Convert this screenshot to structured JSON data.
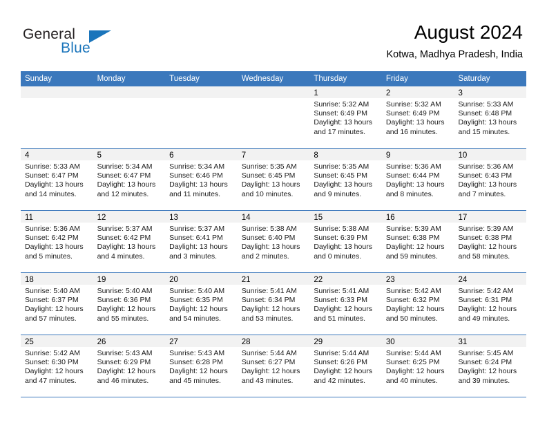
{
  "brand": {
    "name_part1": "General",
    "name_part2": "Blue",
    "accent_color": "#1b75bb"
  },
  "header": {
    "title": "August 2024",
    "subtitle": "Kotwa, Madhya Pradesh, India"
  },
  "calendar": {
    "header_color": "#3b78bc",
    "weekdays": [
      "Sunday",
      "Monday",
      "Tuesday",
      "Wednesday",
      "Thursday",
      "Friday",
      "Saturday"
    ],
    "weeks": [
      [
        {
          "day": "",
          "empty": true
        },
        {
          "day": "",
          "empty": true
        },
        {
          "day": "",
          "empty": true
        },
        {
          "day": "",
          "empty": true
        },
        {
          "day": "1",
          "sunrise": "Sunrise: 5:32 AM",
          "sunset": "Sunset: 6:49 PM",
          "daylight1": "Daylight: 13 hours",
          "daylight2": "and 17 minutes."
        },
        {
          "day": "2",
          "sunrise": "Sunrise: 5:32 AM",
          "sunset": "Sunset: 6:49 PM",
          "daylight1": "Daylight: 13 hours",
          "daylight2": "and 16 minutes."
        },
        {
          "day": "3",
          "sunrise": "Sunrise: 5:33 AM",
          "sunset": "Sunset: 6:48 PM",
          "daylight1": "Daylight: 13 hours",
          "daylight2": "and 15 minutes."
        }
      ],
      [
        {
          "day": "4",
          "sunrise": "Sunrise: 5:33 AM",
          "sunset": "Sunset: 6:47 PM",
          "daylight1": "Daylight: 13 hours",
          "daylight2": "and 14 minutes."
        },
        {
          "day": "5",
          "sunrise": "Sunrise: 5:34 AM",
          "sunset": "Sunset: 6:47 PM",
          "daylight1": "Daylight: 13 hours",
          "daylight2": "and 12 minutes."
        },
        {
          "day": "6",
          "sunrise": "Sunrise: 5:34 AM",
          "sunset": "Sunset: 6:46 PM",
          "daylight1": "Daylight: 13 hours",
          "daylight2": "and 11 minutes."
        },
        {
          "day": "7",
          "sunrise": "Sunrise: 5:35 AM",
          "sunset": "Sunset: 6:45 PM",
          "daylight1": "Daylight: 13 hours",
          "daylight2": "and 10 minutes."
        },
        {
          "day": "8",
          "sunrise": "Sunrise: 5:35 AM",
          "sunset": "Sunset: 6:45 PM",
          "daylight1": "Daylight: 13 hours",
          "daylight2": "and 9 minutes."
        },
        {
          "day": "9",
          "sunrise": "Sunrise: 5:36 AM",
          "sunset": "Sunset: 6:44 PM",
          "daylight1": "Daylight: 13 hours",
          "daylight2": "and 8 minutes."
        },
        {
          "day": "10",
          "sunrise": "Sunrise: 5:36 AM",
          "sunset": "Sunset: 6:43 PM",
          "daylight1": "Daylight: 13 hours",
          "daylight2": "and 7 minutes."
        }
      ],
      [
        {
          "day": "11",
          "sunrise": "Sunrise: 5:36 AM",
          "sunset": "Sunset: 6:42 PM",
          "daylight1": "Daylight: 13 hours",
          "daylight2": "and 5 minutes."
        },
        {
          "day": "12",
          "sunrise": "Sunrise: 5:37 AM",
          "sunset": "Sunset: 6:42 PM",
          "daylight1": "Daylight: 13 hours",
          "daylight2": "and 4 minutes."
        },
        {
          "day": "13",
          "sunrise": "Sunrise: 5:37 AM",
          "sunset": "Sunset: 6:41 PM",
          "daylight1": "Daylight: 13 hours",
          "daylight2": "and 3 minutes."
        },
        {
          "day": "14",
          "sunrise": "Sunrise: 5:38 AM",
          "sunset": "Sunset: 6:40 PM",
          "daylight1": "Daylight: 13 hours",
          "daylight2": "and 2 minutes."
        },
        {
          "day": "15",
          "sunrise": "Sunrise: 5:38 AM",
          "sunset": "Sunset: 6:39 PM",
          "daylight1": "Daylight: 13 hours",
          "daylight2": "and 0 minutes."
        },
        {
          "day": "16",
          "sunrise": "Sunrise: 5:39 AM",
          "sunset": "Sunset: 6:38 PM",
          "daylight1": "Daylight: 12 hours",
          "daylight2": "and 59 minutes."
        },
        {
          "day": "17",
          "sunrise": "Sunrise: 5:39 AM",
          "sunset": "Sunset: 6:38 PM",
          "daylight1": "Daylight: 12 hours",
          "daylight2": "and 58 minutes."
        }
      ],
      [
        {
          "day": "18",
          "sunrise": "Sunrise: 5:40 AM",
          "sunset": "Sunset: 6:37 PM",
          "daylight1": "Daylight: 12 hours",
          "daylight2": "and 57 minutes."
        },
        {
          "day": "19",
          "sunrise": "Sunrise: 5:40 AM",
          "sunset": "Sunset: 6:36 PM",
          "daylight1": "Daylight: 12 hours",
          "daylight2": "and 55 minutes."
        },
        {
          "day": "20",
          "sunrise": "Sunrise: 5:40 AM",
          "sunset": "Sunset: 6:35 PM",
          "daylight1": "Daylight: 12 hours",
          "daylight2": "and 54 minutes."
        },
        {
          "day": "21",
          "sunrise": "Sunrise: 5:41 AM",
          "sunset": "Sunset: 6:34 PM",
          "daylight1": "Daylight: 12 hours",
          "daylight2": "and 53 minutes."
        },
        {
          "day": "22",
          "sunrise": "Sunrise: 5:41 AM",
          "sunset": "Sunset: 6:33 PM",
          "daylight1": "Daylight: 12 hours",
          "daylight2": "and 51 minutes."
        },
        {
          "day": "23",
          "sunrise": "Sunrise: 5:42 AM",
          "sunset": "Sunset: 6:32 PM",
          "daylight1": "Daylight: 12 hours",
          "daylight2": "and 50 minutes."
        },
        {
          "day": "24",
          "sunrise": "Sunrise: 5:42 AM",
          "sunset": "Sunset: 6:31 PM",
          "daylight1": "Daylight: 12 hours",
          "daylight2": "and 49 minutes."
        }
      ],
      [
        {
          "day": "25",
          "sunrise": "Sunrise: 5:42 AM",
          "sunset": "Sunset: 6:30 PM",
          "daylight1": "Daylight: 12 hours",
          "daylight2": "and 47 minutes."
        },
        {
          "day": "26",
          "sunrise": "Sunrise: 5:43 AM",
          "sunset": "Sunset: 6:29 PM",
          "daylight1": "Daylight: 12 hours",
          "daylight2": "and 46 minutes."
        },
        {
          "day": "27",
          "sunrise": "Sunrise: 5:43 AM",
          "sunset": "Sunset: 6:28 PM",
          "daylight1": "Daylight: 12 hours",
          "daylight2": "and 45 minutes."
        },
        {
          "day": "28",
          "sunrise": "Sunrise: 5:44 AM",
          "sunset": "Sunset: 6:27 PM",
          "daylight1": "Daylight: 12 hours",
          "daylight2": "and 43 minutes."
        },
        {
          "day": "29",
          "sunrise": "Sunrise: 5:44 AM",
          "sunset": "Sunset: 6:26 PM",
          "daylight1": "Daylight: 12 hours",
          "daylight2": "and 42 minutes."
        },
        {
          "day": "30",
          "sunrise": "Sunrise: 5:44 AM",
          "sunset": "Sunset: 6:25 PM",
          "daylight1": "Daylight: 12 hours",
          "daylight2": "and 40 minutes."
        },
        {
          "day": "31",
          "sunrise": "Sunrise: 5:45 AM",
          "sunset": "Sunset: 6:24 PM",
          "daylight1": "Daylight: 12 hours",
          "daylight2": "and 39 minutes."
        }
      ]
    ]
  }
}
